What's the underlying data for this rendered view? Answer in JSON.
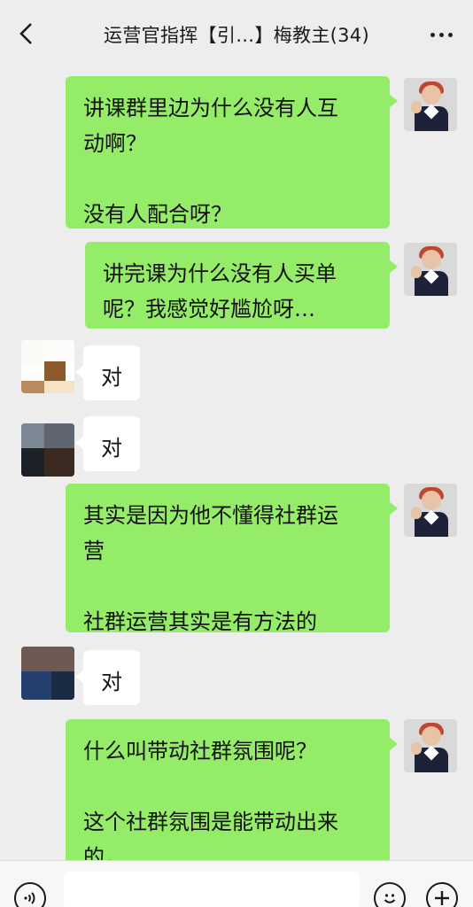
{
  "header": {
    "title": "运营官指挥【引…】梅教主(34)"
  },
  "messages": [
    {
      "side": "right",
      "text": "讲课群里边为什么没有人互\n动啊？\n\n没有人配合呀？"
    },
    {
      "side": "right",
      "text": "讲完课为什么没有人买单\n呢？我感觉好尴尬呀…"
    },
    {
      "side": "left",
      "text": "对"
    },
    {
      "side": "left",
      "text": "对"
    },
    {
      "side": "right",
      "text": "其实是因为他不懂得社群运\n营\n\n社群运营其实是有方法的"
    },
    {
      "side": "left",
      "text": "对"
    },
    {
      "side": "right",
      "text": "什么叫带动社群氛围呢？\n\n这个社群氛围是能带动出来\n的，"
    }
  ],
  "input_bar": {
    "voice_icon": "voice-icon",
    "emoji_icon": "emoji-icon",
    "plus_icon": "plus-icon",
    "text_value": ""
  },
  "colors": {
    "self_bubble": "#95ec69",
    "other_bubble": "#ffffff",
    "background": "#ededed"
  }
}
